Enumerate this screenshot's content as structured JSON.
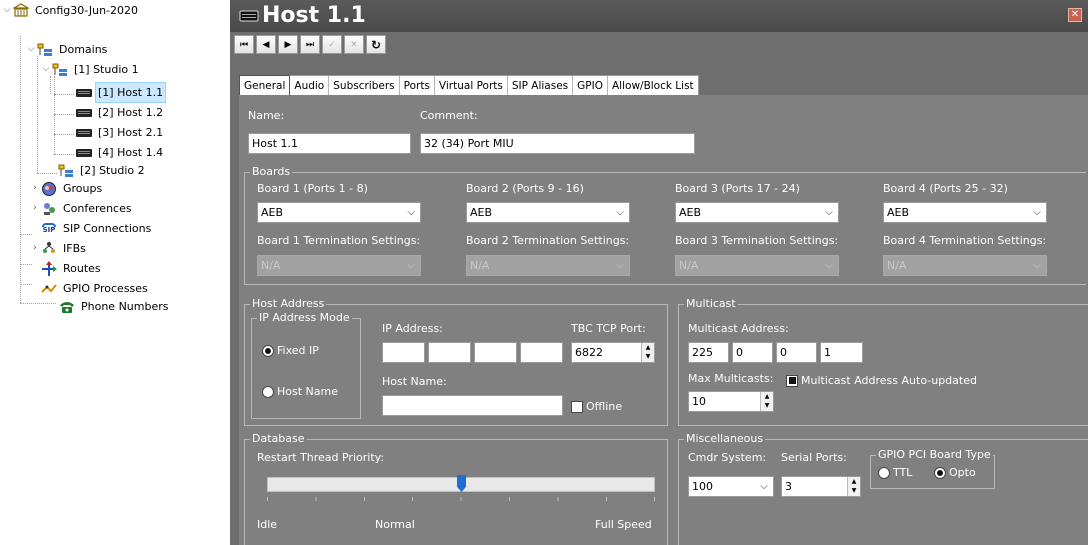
{
  "tree": {
    "root": "Config30-Jun-2020",
    "domains": "Domains",
    "studio1": "[1] Studio 1",
    "hosts": [
      "[1] Host 1.1",
      "[2] Host 1.2",
      "[3] Host 2.1",
      "[4] Host 1.4"
    ],
    "studio2": "[2] Studio 2",
    "groups": "Groups",
    "conferences": "Conferences",
    "sip_connections": "SIP Connections",
    "ifbs": "IFBs",
    "routes": "Routes",
    "gpio_processes": "GPIO Processes",
    "phone_numbers": "Phone Numbers",
    "sip_icon_text": "SIP"
  },
  "window": {
    "title": "Host 1.1",
    "close_glyph": "✕"
  },
  "toolbar": {
    "first": "⏮",
    "prev": "◀",
    "next": "▶",
    "last": "⏭",
    "accept": "✓",
    "cancel": "✕",
    "refresh": "↻"
  },
  "tabs": [
    "General",
    "Audio",
    "Subscribers",
    "Ports",
    "Virtual Ports",
    "SIP Aliases",
    "GPIO",
    "Allow/Block List"
  ],
  "general": {
    "name_label": "Name:",
    "name_value": "Host 1.1",
    "comment_label": "Comment:",
    "comment_value": "32 (34) Port MIU"
  },
  "boards": {
    "title": "Boards",
    "items": [
      {
        "label": "Board 1 (Ports 1 - 8)",
        "value": "AEB",
        "term_label": "Board 1 Termination Settings:",
        "term_value": "N/A"
      },
      {
        "label": "Board 2 (Ports 9 - 16)",
        "value": "AEB",
        "term_label": "Board 2 Termination Settings:",
        "term_value": "N/A"
      },
      {
        "label": "Board 3 (Ports 17 - 24)",
        "value": "AEB",
        "term_label": "Board 3 Termination Settings:",
        "term_value": "N/A"
      },
      {
        "label": "Board 4 (Ports 25 - 32)",
        "value": "AEB",
        "term_label": "Board 4 Termination Settings:",
        "term_value": "N/A"
      }
    ]
  },
  "host_address": {
    "title": "Host Address",
    "mode_title": "IP Address Mode",
    "fixed_ip": "Fixed IP",
    "host_name_opt": "Host Name",
    "ip_label": "IP Address:",
    "host_name_label": "Host Name:",
    "tbc_label": "TBC TCP Port:",
    "tbc_value": "6822",
    "offline": "Offline"
  },
  "multicast": {
    "title": "Multicast",
    "address_label": "Multicast Address:",
    "octets": [
      "225",
      "0",
      "0",
      "1"
    ],
    "max_label": "Max Multicasts:",
    "max_value": "10",
    "auto_label": "Multicast Address Auto-updated"
  },
  "database": {
    "title": "Database",
    "priority_label": "Restart Thread Priority:",
    "idle": "Idle",
    "normal": "Normal",
    "full": "Full Speed",
    "slider_level": 0.5
  },
  "misc": {
    "title": "Miscellaneous",
    "cmdr_label": "Cmdr System:",
    "cmdr_value": "100",
    "serial_label": "Serial Ports:",
    "serial_value": "3",
    "gpio_title": "GPIO PCI Board Type",
    "ttl": "TTL",
    "opto": "Opto"
  }
}
